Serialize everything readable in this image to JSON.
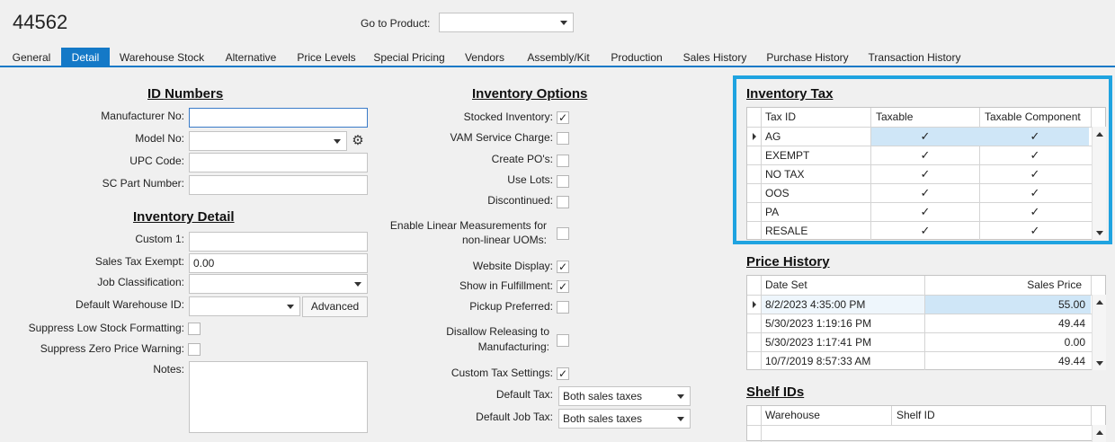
{
  "header": {
    "title": "44562",
    "go_to_label": "Go to Product:",
    "go_to_value": ""
  },
  "tabs": [
    {
      "label": "General"
    },
    {
      "label": "Detail"
    },
    {
      "label": "Warehouse Stock"
    },
    {
      "label": "Alternative"
    },
    {
      "label": "Price Levels"
    },
    {
      "label": "Special Pricing"
    },
    {
      "label": "Vendors"
    },
    {
      "label": "Assembly/Kit"
    },
    {
      "label": "Production"
    },
    {
      "label": "Sales History"
    },
    {
      "label": "Purchase History"
    },
    {
      "label": "Transaction History"
    }
  ],
  "active_tab": "Detail",
  "id_numbers": {
    "heading": "ID Numbers",
    "manufacturer_label": "Manufacturer No:",
    "manufacturer_value": "",
    "model_label": "Model No:",
    "model_value": "",
    "upc_label": "UPC Code:",
    "upc_value": "",
    "sc_label": "SC Part Number:",
    "sc_value": ""
  },
  "inventory_detail": {
    "heading": "Inventory Detail",
    "custom1_label": "Custom 1:",
    "custom1_value": "",
    "sales_tax_label": "Sales Tax Exempt:",
    "sales_tax_value": "0.00",
    "job_class_label": "Job Classification:",
    "job_class_value": "",
    "warehouse_label": "Default Warehouse ID:",
    "warehouse_value": "",
    "advanced_label": "Advanced",
    "suppress_low_label": "Suppress Low Stock Formatting:",
    "suppress_low": false,
    "suppress_zero_label": "Suppress Zero Price Warning:",
    "suppress_zero": false,
    "notes_label": "Notes:",
    "notes_value": ""
  },
  "inventory_options": {
    "heading": "Inventory Options",
    "items": [
      {
        "label": "Stocked Inventory:",
        "checked": true
      },
      {
        "label": "VAM Service Charge:",
        "checked": false
      },
      {
        "label": "Create PO's:",
        "checked": false
      },
      {
        "label": "Use Lots:",
        "checked": false
      },
      {
        "label": "Discontinued:",
        "checked": false
      },
      {
        "label": "Enable Linear Measurements for",
        "label2": "non-linear UOMs:",
        "checked": false
      },
      {
        "label": "Website Display:",
        "checked": true
      },
      {
        "label": "Show in Fulfillment:",
        "checked": true
      },
      {
        "label": "Pickup Preferred:",
        "checked": false
      },
      {
        "label": "Disallow Releasing to",
        "label2": "Manufacturing:",
        "checked": false
      },
      {
        "label": "Custom Tax Settings:",
        "checked": true
      }
    ],
    "default_tax_label": "Default Tax:",
    "default_tax_value": "Both sales taxes",
    "default_job_tax_label": "Default Job Tax:",
    "default_job_tax_value": "Both sales taxes"
  },
  "inventory_tax": {
    "heading": "Inventory Tax",
    "columns": [
      "Tax ID",
      "Taxable",
      "Taxable Component"
    ],
    "rows": [
      {
        "tax_id": "AG",
        "taxable": true,
        "component": true
      },
      {
        "tax_id": "EXEMPT",
        "taxable": true,
        "component": true
      },
      {
        "tax_id": "NO TAX",
        "taxable": true,
        "component": true
      },
      {
        "tax_id": "OOS",
        "taxable": true,
        "component": true
      },
      {
        "tax_id": "PA",
        "taxable": true,
        "component": true
      },
      {
        "tax_id": "RESALE",
        "taxable": true,
        "component": true
      }
    ],
    "highlight_color": "#1fa3e0"
  },
  "price_history": {
    "heading": "Price History",
    "columns": [
      "Date Set",
      "Sales Price"
    ],
    "rows": [
      {
        "date": "8/2/2023 4:35:00 PM",
        "price": "55.00"
      },
      {
        "date": "5/30/2023 1:19:16 PM",
        "price": "49.44"
      },
      {
        "date": "5/30/2023 1:17:41 PM",
        "price": "0.00"
      },
      {
        "date": "10/7/2019 8:57:33 AM",
        "price": "49.44"
      }
    ]
  },
  "shelf_ids": {
    "heading": "Shelf IDs",
    "columns": [
      "Warehouse",
      "Shelf ID"
    ]
  },
  "colors": {
    "accent": "#1479c7",
    "selection": "#cfe6f7"
  }
}
